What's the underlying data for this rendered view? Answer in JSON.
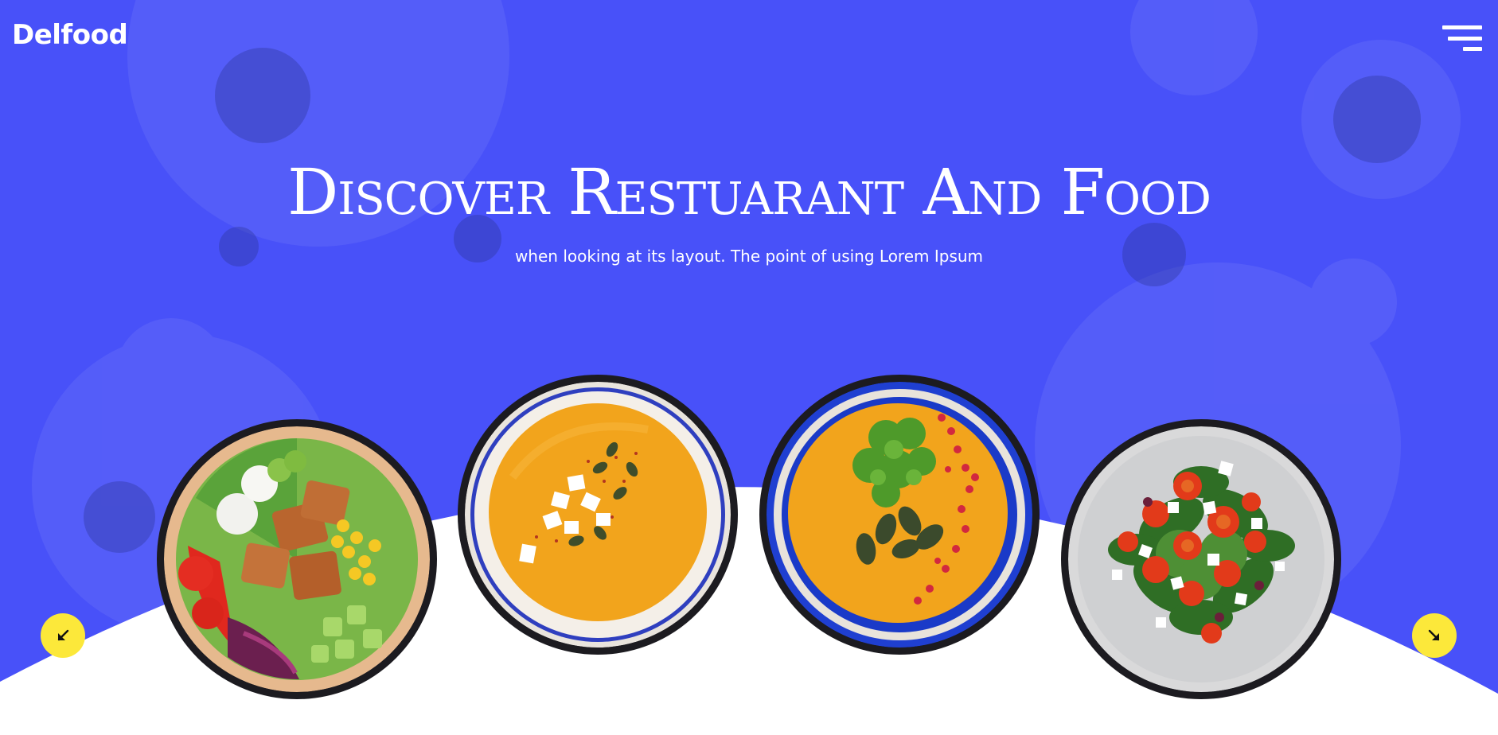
{
  "brand": {
    "logo_text": "Delfood"
  },
  "header": {
    "menu_icon": "hamburger-menu-icon"
  },
  "hero": {
    "title": "Discover Restuarant And Food",
    "subtitle": "when looking at its layout. The point of using Lorem Ipsum"
  },
  "colors": {
    "hero_background": "#4851f9",
    "accent_button": "#fce83a",
    "text_light": "#ffffff",
    "dish_frame": "#1c1b20"
  },
  "slider": {
    "prev_icon": "arrow-down-left-icon",
    "next_icon": "arrow-down-right-icon",
    "dishes": [
      {
        "name": "salad-bowl-tofu-image"
      },
      {
        "name": "pumpkin-soup-feta-image"
      },
      {
        "name": "pumpkin-soup-herbs-image"
      },
      {
        "name": "greek-salad-plate-image"
      }
    ]
  }
}
